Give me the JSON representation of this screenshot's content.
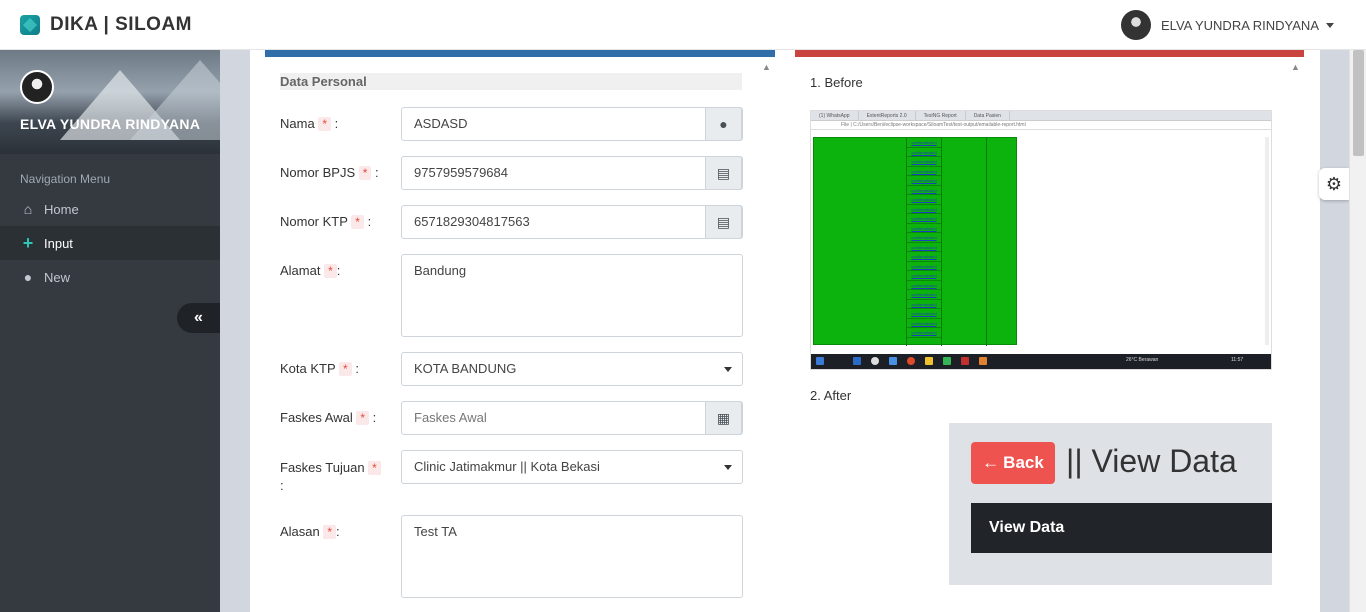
{
  "app": {
    "brand": "DIKA | SILOAM",
    "user": "ELVA YUNDRA RINDYANA"
  },
  "sidebar": {
    "username": "ELVA YUNDRA RINDYANA",
    "nav_header": "Navigation Menu",
    "items": [
      {
        "label": "Home",
        "icon": "home-icon"
      },
      {
        "label": "Input",
        "icon": "plus-icon",
        "active": true
      },
      {
        "label": "New",
        "icon": "user-icon"
      }
    ],
    "collapse_icon": "«"
  },
  "form": {
    "section_title": "Data Personal",
    "required_mark": "*",
    "fields": {
      "nama": {
        "label": "Nama",
        "value": "ASDASD"
      },
      "bpjs": {
        "label": "Nomor BPJS",
        "value": "9757959579684"
      },
      "ktp": {
        "label": "Nomor KTP",
        "value": "6571829304817563"
      },
      "alamat": {
        "label": "Alamat",
        "value": "Bandung"
      },
      "kota": {
        "label": "Kota KTP",
        "value": "KOTA BANDUNG"
      },
      "faskes_awal": {
        "label": "Faskes Awal",
        "placeholder": "Faskes Awal"
      },
      "faskes_tujuan": {
        "label": "Faskes Tujuan",
        "value": "Clinic Jatimakmur || Kota Bekasi"
      },
      "alasan": {
        "label": "Alasan",
        "value": "Test TA"
      }
    }
  },
  "right": {
    "before_title": "1. Before",
    "after_title": "2. After",
    "screenshot": {
      "tabs": [
        "(1) WhatsApp",
        "ExtentReports 2.0",
        "TestNG Report",
        "Data Pasien"
      ],
      "url": "File | C:/Users/Beni/eclipse-workspace/SiloamTest/test-output/emailable-report.html",
      "row_text": "confirmationId",
      "taskbar_weather": "26°C  Berawan",
      "taskbar_time": "11:57"
    },
    "after": {
      "back_label": "Back",
      "title": "|| View Data",
      "bar_title": "View Data"
    }
  },
  "colors": {
    "left_card_accent": "#2f6ea8",
    "right_card_accent": "#c9443e",
    "back_button": "#ef5350"
  }
}
